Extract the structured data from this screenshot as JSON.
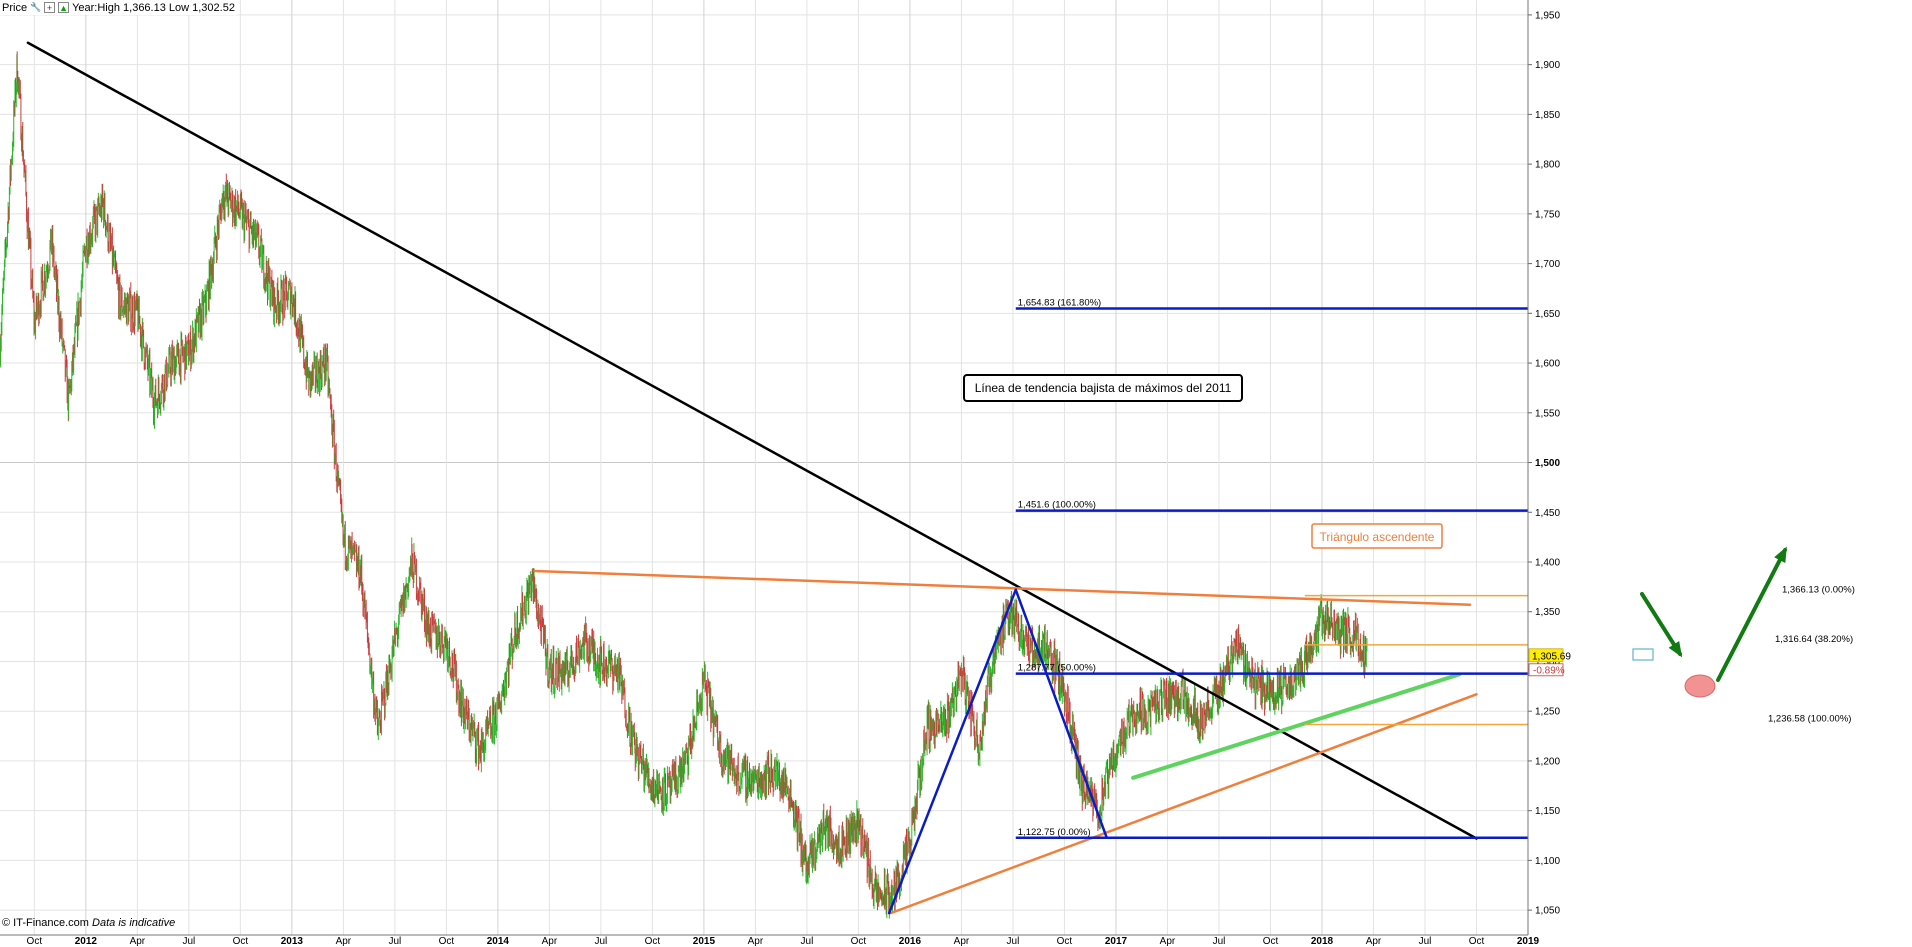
{
  "toolbar": {
    "title": "Price",
    "year_label": "Year:High 1,366.13 Low 1,302.52"
  },
  "footer": {
    "brand": "© IT-Finance.com",
    "note": "Data is indicative"
  },
  "price_tag": {
    "last": "1,305.69",
    "change": "-0.89%"
  },
  "chart_data": {
    "type": "line",
    "series_style": "ohlc-bars",
    "xlabel": "",
    "ylabel": "",
    "ylim": [
      1025,
      1965
    ],
    "y_ticks": [
      1050,
      1100,
      1150,
      1200,
      1250,
      1300,
      1350,
      1400,
      1450,
      1500,
      1550,
      1600,
      1650,
      1700,
      1750,
      1800,
      1850,
      1900,
      1950
    ],
    "y_major": 1500,
    "x_ticks": [
      {
        "label": "Oct",
        "date": "2011-10"
      },
      {
        "label": "2012",
        "date": "2012-01",
        "major": true
      },
      {
        "label": "Apr",
        "date": "2012-04"
      },
      {
        "label": "Jul",
        "date": "2012-07"
      },
      {
        "label": "Oct",
        "date": "2012-10"
      },
      {
        "label": "2013",
        "date": "2013-01",
        "major": true
      },
      {
        "label": "Apr",
        "date": "2013-04"
      },
      {
        "label": "Jul",
        "date": "2013-07"
      },
      {
        "label": "Oct",
        "date": "2013-10"
      },
      {
        "label": "2014",
        "date": "2014-01",
        "major": true
      },
      {
        "label": "Apr",
        "date": "2014-04"
      },
      {
        "label": "Jul",
        "date": "2014-07"
      },
      {
        "label": "Oct",
        "date": "2014-10"
      },
      {
        "label": "2015",
        "date": "2015-01",
        "major": true
      },
      {
        "label": "Apr",
        "date": "2015-04"
      },
      {
        "label": "Jul",
        "date": "2015-07"
      },
      {
        "label": "Oct",
        "date": "2015-10"
      },
      {
        "label": "2016",
        "date": "2016-01",
        "major": true
      },
      {
        "label": "Apr",
        "date": "2016-04"
      },
      {
        "label": "Jul",
        "date": "2016-07"
      },
      {
        "label": "Oct",
        "date": "2016-10"
      },
      {
        "label": "2017",
        "date": "2017-01",
        "major": true
      },
      {
        "label": "Apr",
        "date": "2017-04"
      },
      {
        "label": "Jul",
        "date": "2017-07"
      },
      {
        "label": "Oct",
        "date": "2017-10"
      },
      {
        "label": "2018",
        "date": "2018-01",
        "major": true
      },
      {
        "label": "Apr",
        "date": "2018-04"
      },
      {
        "label": "Jul",
        "date": "2018-07"
      },
      {
        "label": "Oct",
        "date": "2018-10"
      },
      {
        "label": "2019",
        "date": "2019-01",
        "major": true
      }
    ],
    "x_range": [
      "2011-08",
      "2019-01"
    ],
    "series": [
      {
        "values_by_date": [
          [
            "2011-08",
            1620
          ],
          [
            "2011-09",
            1900
          ],
          [
            "2011-10",
            1640
          ],
          [
            "2011-11",
            1720
          ],
          [
            "2011-12",
            1560
          ],
          [
            "2012-01",
            1720
          ],
          [
            "2012-02",
            1760
          ],
          [
            "2012-03",
            1660
          ],
          [
            "2012-04",
            1650
          ],
          [
            "2012-05",
            1560
          ],
          [
            "2012-06",
            1600
          ],
          [
            "2012-07",
            1610
          ],
          [
            "2012-08",
            1660
          ],
          [
            "2012-09",
            1770
          ],
          [
            "2012-10",
            1750
          ],
          [
            "2012-11",
            1720
          ],
          [
            "2012-12",
            1660
          ],
          [
            "2013-01",
            1670
          ],
          [
            "2013-02",
            1580
          ],
          [
            "2013-03",
            1600
          ],
          [
            "2013-04",
            1420
          ],
          [
            "2013-05",
            1390
          ],
          [
            "2013-06",
            1230
          ],
          [
            "2013-07",
            1320
          ],
          [
            "2013-08",
            1400
          ],
          [
            "2013-09",
            1330
          ],
          [
            "2013-10",
            1320
          ],
          [
            "2013-11",
            1250
          ],
          [
            "2013-12",
            1210
          ],
          [
            "2014-01",
            1250
          ],
          [
            "2014-02",
            1330
          ],
          [
            "2014-03",
            1380
          ],
          [
            "2014-04",
            1290
          ],
          [
            "2014-05",
            1290
          ],
          [
            "2014-06",
            1320
          ],
          [
            "2014-07",
            1300
          ],
          [
            "2014-08",
            1290
          ],
          [
            "2014-09",
            1210
          ],
          [
            "2014-10",
            1175
          ],
          [
            "2014-11",
            1170
          ],
          [
            "2014-12",
            1200
          ],
          [
            "2015-01",
            1280
          ],
          [
            "2015-02",
            1210
          ],
          [
            "2015-03",
            1185
          ],
          [
            "2015-04",
            1180
          ],
          [
            "2015-05",
            1190
          ],
          [
            "2015-06",
            1170
          ],
          [
            "2015-07",
            1090
          ],
          [
            "2015-08",
            1135
          ],
          [
            "2015-09",
            1115
          ],
          [
            "2015-10",
            1140
          ],
          [
            "2015-11",
            1065
          ],
          [
            "2015-12",
            1065
          ],
          [
            "2016-01",
            1115
          ],
          [
            "2016-02",
            1235
          ],
          [
            "2016-03",
            1235
          ],
          [
            "2016-04",
            1290
          ],
          [
            "2016-05",
            1215
          ],
          [
            "2016-06",
            1320
          ],
          [
            "2016-07",
            1350
          ],
          [
            "2016-08",
            1310
          ],
          [
            "2016-09",
            1315
          ],
          [
            "2016-10",
            1270
          ],
          [
            "2016-11",
            1175
          ],
          [
            "2016-12",
            1150
          ],
          [
            "2017-01",
            1210
          ],
          [
            "2017-02",
            1250
          ],
          [
            "2017-03",
            1250
          ],
          [
            "2017-04",
            1265
          ],
          [
            "2017-05",
            1265
          ],
          [
            "2017-06",
            1240
          ],
          [
            "2017-07",
            1270
          ],
          [
            "2017-08",
            1320
          ],
          [
            "2017-09",
            1280
          ],
          [
            "2017-10",
            1270
          ],
          [
            "2017-11",
            1275
          ],
          [
            "2017-12",
            1300
          ],
          [
            "2018-01",
            1345
          ],
          [
            "2018-02",
            1330
          ],
          [
            "2018-03",
            1325
          ],
          [
            "2018-03-20",
            1306
          ]
        ]
      }
    ],
    "price_levels": [
      {
        "label": "1,654.83 (161.80%)",
        "value": 1654.83,
        "color": "#0a1cc8"
      },
      {
        "label": "1,451.6 (100.00%)",
        "value": 1451.6,
        "color": "#0a1cc8"
      },
      {
        "label": "1,287.77 (50.00%)",
        "value": 1287.77,
        "color": "#0a1cc8"
      },
      {
        "label": "1,122.75 (0.00%)",
        "value": 1122.75,
        "color": "#0a1cc8"
      },
      {
        "label": "1,366.13 (0.00%)",
        "value": 1366.13,
        "color": "#f2a73c"
      },
      {
        "label": "1,316.64 (38.20%)",
        "value": 1316.64,
        "color": "#f2a73c"
      },
      {
        "label": "1,236.58 (100.00%)",
        "value": 1236.58,
        "color": "#f2a73c"
      }
    ],
    "annotations": [
      {
        "text": "Línea de tendencia bajista de máximos del 2011",
        "border": "#000000",
        "color": "#000000"
      },
      {
        "text": "Triángulo ascendente",
        "border": "#f07f3c",
        "color": "#f07f3c"
      }
    ],
    "colors": {
      "up_bar": "#2db52d",
      "down_bar": "#c83c3c",
      "downtrend": "#000000",
      "triangle": "#f07f3c",
      "fib_blue": "#0a1cc8",
      "fib_orange": "#f2a73c",
      "support": "#5fd35f",
      "arrow": "#127a12",
      "grid": "#e3e3e3",
      "price_tag": "#ffee00"
    }
  }
}
